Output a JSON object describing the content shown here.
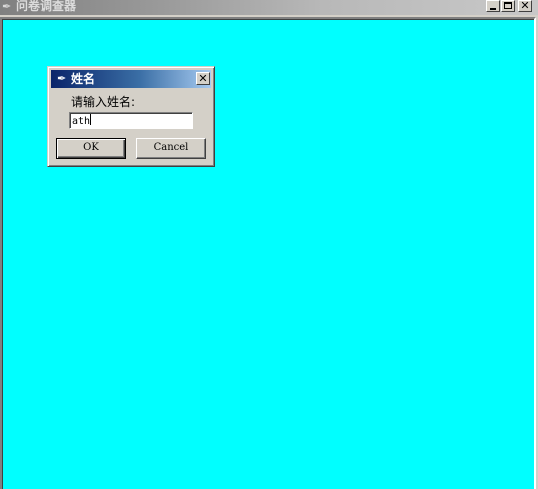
{
  "main_window": {
    "title": "问卷调查器",
    "icon": "feather-icon",
    "client_bg": "#00ffff",
    "controls": {
      "minimize": "minimize-icon",
      "maximize": "maximize-icon",
      "close": "close-icon"
    }
  },
  "dialog": {
    "title": "姓名",
    "icon": "feather-icon",
    "close_glyph": "✕",
    "prompt": "请输入姓名:",
    "input_value": "ath",
    "ok_label": "OK",
    "cancel_label": "Cancel",
    "title_gradient_start": "#0a246a",
    "title_gradient_end": "#a6caf0"
  }
}
